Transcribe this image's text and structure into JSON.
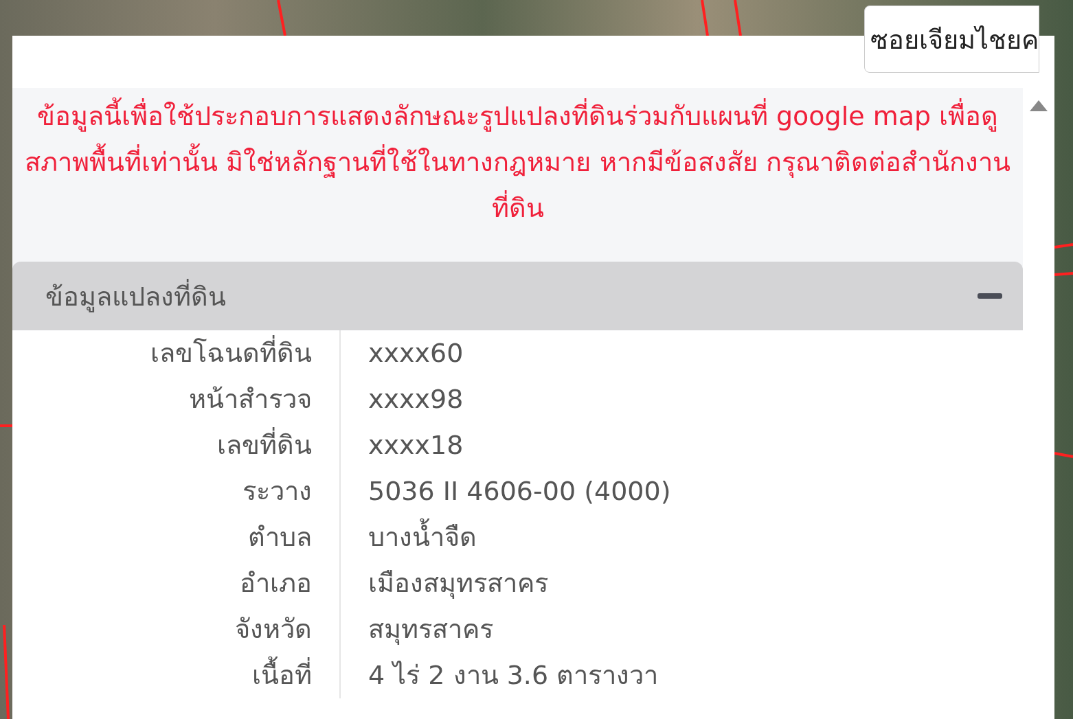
{
  "map_label": "ซอยเจียมไชยค",
  "notice": "ข้อมูลนี้เพื่อใช้ประกอบการแสดงลักษณะรูปแปลงที่ดินร่วมกับแผนที่ google map เพื่อดูสภาพพื้นที่เท่านั้น มิใช่หลักฐานที่ใช้ในทางกฎหมาย หากมีข้อสงสัย กรุณาติดต่อสำนักงานที่ดิน",
  "section": {
    "title": "ข้อมูลแปลงที่ดิน",
    "expanded": true
  },
  "rows": [
    {
      "label": "เลขโฉนดที่ดิน",
      "value": "xxxx60"
    },
    {
      "label": "หน้าสำรวจ",
      "value": "xxxx98"
    },
    {
      "label": "เลขที่ดิน",
      "value": "xxxx18"
    },
    {
      "label": "ระวาง",
      "value": "5036 II 4606-00 (4000)"
    },
    {
      "label": "ตำบล",
      "value": "บางน้ำจืด"
    },
    {
      "label": "อำเภอ",
      "value": "เมืองสมุทรสาคร"
    },
    {
      "label": "จังหวัด",
      "value": "สมุทรสาคร"
    },
    {
      "label": "เนื้อที่",
      "value": "4 ไร่ 2 งาน 3.6 ตารางวา"
    }
  ]
}
